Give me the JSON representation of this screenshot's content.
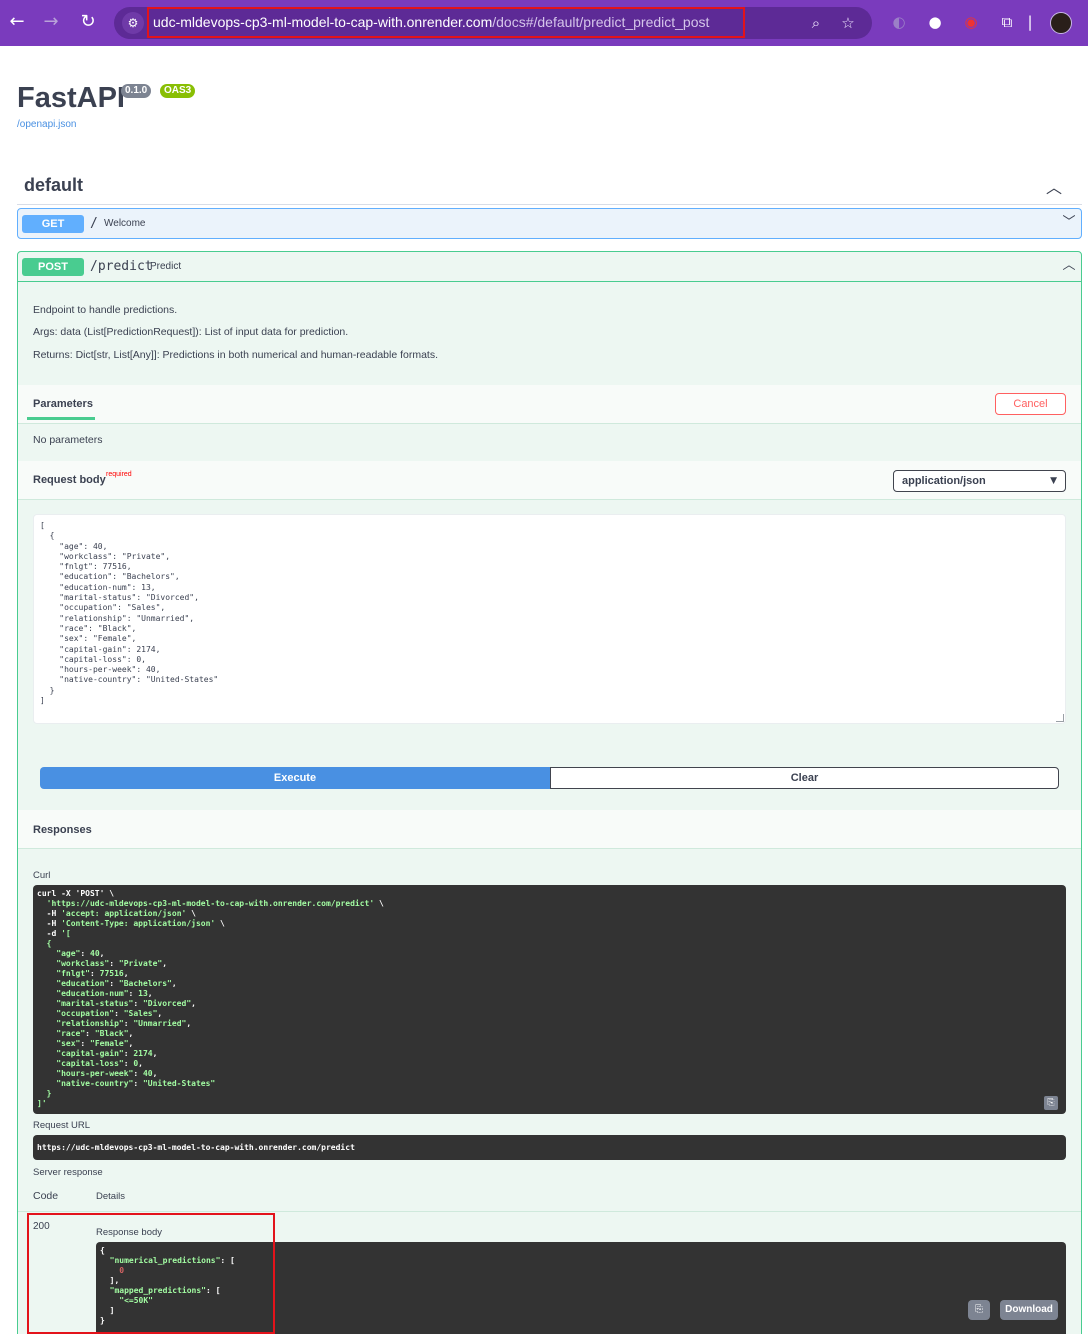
{
  "browser": {
    "url_host": "udc-mldevops-cp3-ml-model-to-cap-with.onrender.com",
    "url_path": "/docs#/default/predict_predict_post",
    "icons": [
      "back-arrow-icon",
      "forward-arrow-icon",
      "reload-icon",
      "site-info-icon",
      "zoom-icon",
      "bookmark-star-icon",
      "extensions-icon",
      "menu-icon"
    ]
  },
  "api": {
    "title": "FastAPI",
    "version": "0.1.0",
    "oas": "OAS3",
    "openapi_link": "/openapi.json"
  },
  "tag": {
    "name": "default"
  },
  "get_op": {
    "method": "GET",
    "path": "/",
    "summary": "Welcome"
  },
  "post_op": {
    "method": "POST",
    "path": "/predict",
    "summary": "Predict",
    "description": [
      "Endpoint to handle predictions.",
      "Args: data (List[PredictionRequest]): List of input data for prediction.",
      "Returns: Dict[str, List[Any]]: Predictions in both numerical and human-readable formats."
    ],
    "parameters_tab": "Parameters",
    "cancel_label": "Cancel",
    "no_parameters": "No parameters",
    "request_body_label": "Request body",
    "required_label": "required",
    "content_type": "application/json",
    "request_body": "[\n  {\n    \"age\": 40,\n    \"workclass\": \"Private\",\n    \"fnlgt\": 77516,\n    \"education\": \"Bachelors\",\n    \"education-num\": 13,\n    \"marital-status\": \"Divorced\",\n    \"occupation\": \"Sales\",\n    \"relationship\": \"Unmarried\",\n    \"race\": \"Black\",\n    \"sex\": \"Female\",\n    \"capital-gain\": 2174,\n    \"capital-loss\": 0,\n    \"hours-per-week\": 40,\n    \"native-country\": \"United-States\"\n  }\n]",
    "execute_label": "Execute",
    "clear_label": "Clear",
    "responses_label": "Responses",
    "curl_label": "Curl",
    "request_url_label": "Request URL",
    "request_url": "https://udc-mldevops-cp3-ml-model-to-cap-with.onrender.com/predict",
    "server_response_label": "Server response",
    "code_header": "Code",
    "details_header": "Details",
    "response_code": "200",
    "response_body_label": "Response body",
    "download_label": "Download"
  },
  "curl": {
    "line1": "curl -X 'POST' \\",
    "url": "'https://udc-mldevops-cp3-ml-model-to-cap-with.onrender.com/predict'",
    "accept": "'accept: application/json'",
    "content_type": "'Content-Type: application/json'",
    "data_open": "'[",
    "fields": [
      [
        "\"age\"",
        "40"
      ],
      [
        "\"workclass\"",
        "\"Private\""
      ],
      [
        "\"fnlgt\"",
        "77516"
      ],
      [
        "\"education\"",
        "\"Bachelors\""
      ],
      [
        "\"education-num\"",
        "13"
      ],
      [
        "\"marital-status\"",
        "\"Divorced\""
      ],
      [
        "\"occupation\"",
        "\"Sales\""
      ],
      [
        "\"relationship\"",
        "\"Unmarried\""
      ],
      [
        "\"race\"",
        "\"Black\""
      ],
      [
        "\"sex\"",
        "\"Female\""
      ],
      [
        "\"capital-gain\"",
        "2174"
      ],
      [
        "\"capital-loss\"",
        "0"
      ],
      [
        "\"hours-per-week\"",
        "40"
      ],
      [
        "\"native-country\"",
        "\"United-States\""
      ]
    ]
  },
  "response": {
    "numerical_key": "\"numerical_predictions\"",
    "numerical_value": "0",
    "mapped_key": "\"mapped_predictions\"",
    "mapped_value": "\"<=50K\""
  }
}
